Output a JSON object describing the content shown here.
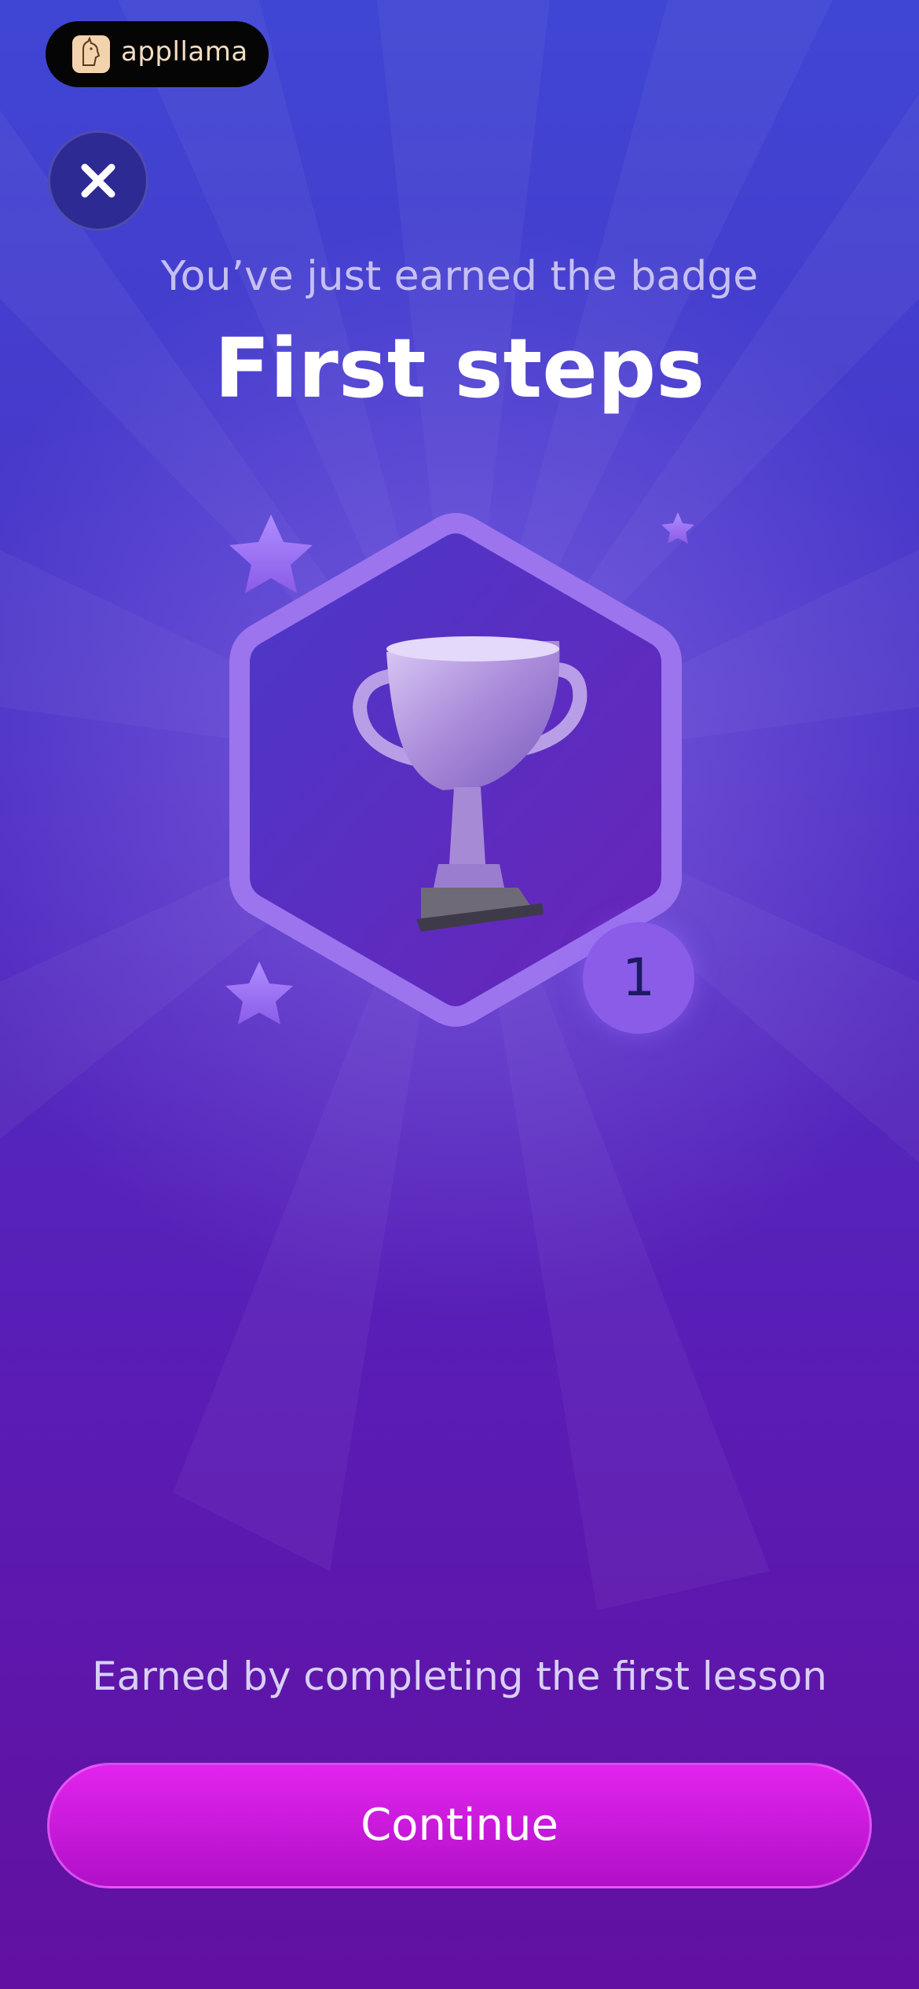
{
  "app": {
    "brand_name": "appllama",
    "brand_icon": "llama-logo-icon"
  },
  "close_button": {
    "icon": "close-icon"
  },
  "badge_screen": {
    "subtitle": "You’ve just earned the badge",
    "title": "First steps",
    "badge_icon": "trophy-icon",
    "badge_count": "1",
    "description": "Earned by completing the first lesson"
  },
  "actions": {
    "continue_label": "Continue"
  },
  "colors": {
    "background_top": "#3f46d4",
    "background_bottom": "#62109f",
    "button": "#d51ce6",
    "badge_accent": "#8a5ce8"
  }
}
